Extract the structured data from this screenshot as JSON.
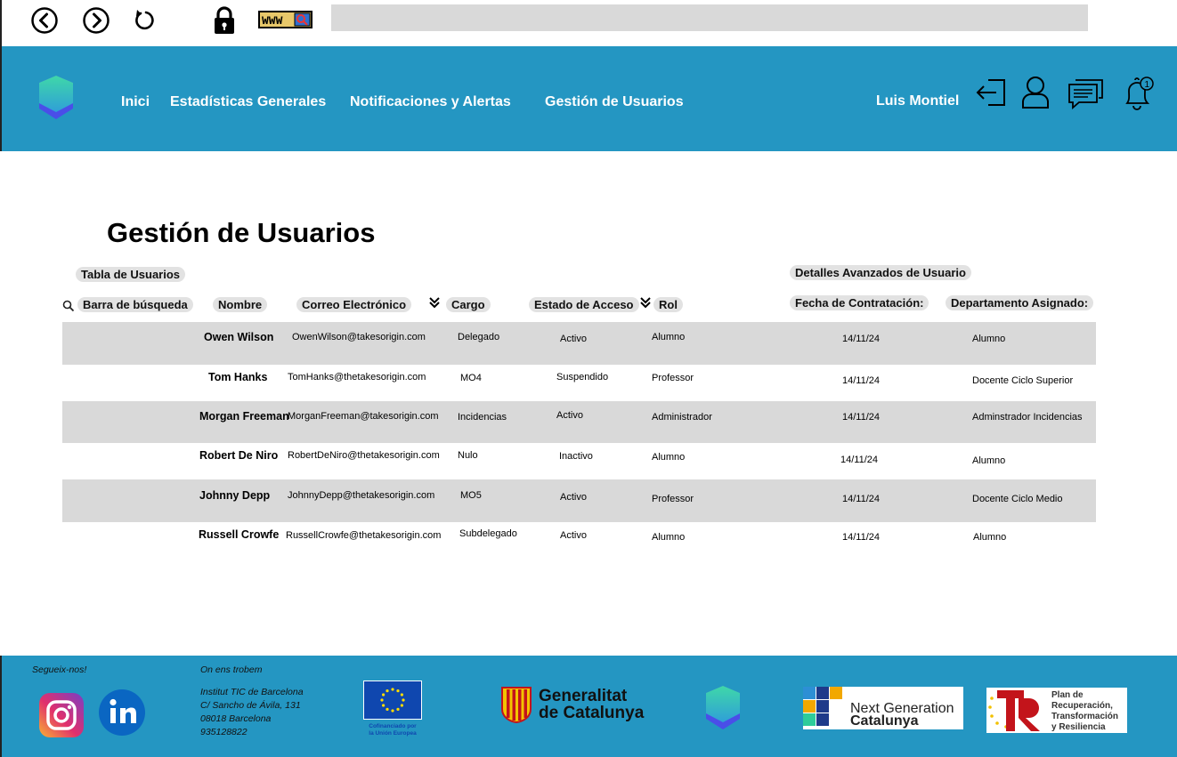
{
  "browser": {
    "back_icon": "chevron-left-circle-icon",
    "forward_icon": "chevron-right-circle-icon",
    "reload_icon": "reload-icon",
    "lock_icon": "lock-icon",
    "www_label": "WWW",
    "address": ""
  },
  "header": {
    "nav": [
      "Inici",
      "Estadísticas Generales",
      "Notificaciones y Alertas",
      "Gestión de Usuarios"
    ],
    "user_name": "Luis Montiel",
    "notification_count": "1",
    "colors": {
      "header_bg": "#2496c2",
      "logo_top": "#3fd8a8",
      "logo_bottom": "#4a4ee8"
    }
  },
  "main": {
    "title": "Gestión de Usuarios",
    "table_label": "Tabla de Usuarios",
    "advanced_label": "Detalles Avanzados de Usuario",
    "columns": {
      "search": "Barra de búsqueda",
      "name": "Nombre",
      "email": "Correo Electrónico",
      "cargo": "Cargo",
      "estado": "Estado de Acceso",
      "rol": "Rol",
      "fecha": "Fecha de Contratación:",
      "departamento": "Departamento Asignado:"
    },
    "rows": [
      {
        "name": "Owen Wilson",
        "email": "OwenWilson@takesorigin.com",
        "cargo": "Delegado",
        "estado": "Activo",
        "rol": "Alumno",
        "fecha": "14/11/24",
        "departamento": "Alumno"
      },
      {
        "name": "Tom Hanks",
        "email": "TomHanks@thetakesorigin.com",
        "cargo": "MO4",
        "estado": "Suspendido",
        "rol": "Professor",
        "fecha": "14/11/24",
        "departamento": "Docente Ciclo Superior"
      },
      {
        "name": "Morgan Freeman",
        "email": "MorganFreeman@takesorigin.com",
        "cargo": "Incidencias",
        "estado": "Activo",
        "rol": "Administrador",
        "fecha": "14/11/24",
        "departamento": "Adminstrador Incidencias"
      },
      {
        "name": "Robert De Niro",
        "email": "RobertDeNiro@thetakesorigin.com",
        "cargo": "Nulo",
        "estado": "Inactivo",
        "rol": "Alumno",
        "fecha": "14/11/24",
        "departamento": "Alumno"
      },
      {
        "name": "Johnny Depp",
        "email": "JohnnyDepp@thetakesorigin.com",
        "cargo": "MO5",
        "estado": "Activo",
        "rol": "Professor",
        "fecha": "14/11/24",
        "departamento": "Docente Ciclo Medio"
      },
      {
        "name": "Russell Crowfe",
        "email": "RussellCrowfe@thetakesorigin.com",
        "cargo": "Subdelegado",
        "estado": "Activo",
        "rol": "Alumno",
        "fecha": "14/11/24",
        "departamento": "Alumno"
      }
    ]
  },
  "footer": {
    "follow_label": "Segueix-nos!",
    "location_label": "On ens trobem",
    "address_lines": [
      "Institut TIC de Barcelona",
      "C/ Sancho de Ávila, 131",
      "08018 Barcelona",
      "935128822"
    ],
    "eu_caption_1": "Cofinanciado por",
    "eu_caption_2": "la Unión Europea",
    "gencat_line1": "Generalitat",
    "gencat_line2": "de Catalunya",
    "ng_line1": "Next Generation",
    "ng_line2": "Catalunya",
    "prtr_lines": [
      "Plan de",
      "Recuperación,",
      "Transformación",
      "y Resiliencia"
    ]
  }
}
